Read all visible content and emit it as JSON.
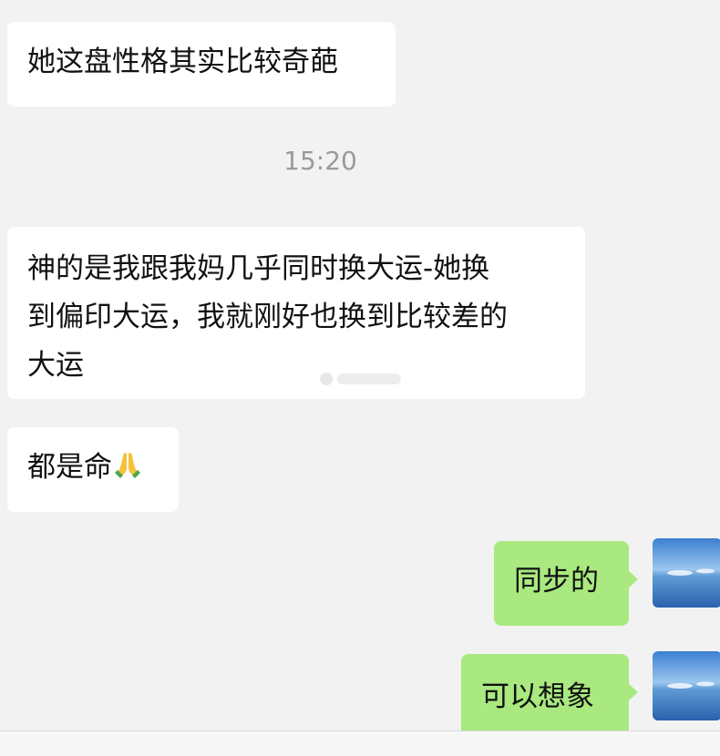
{
  "chat": {
    "timestamp": "15:20",
    "messages": [
      {
        "side": "incoming",
        "text": "她这盘性格其实比较奇葩"
      },
      {
        "side": "incoming",
        "text": "神的是我跟我妈几乎同时换大运-她换\n到偏印大运，我就刚好也换到比较差的\n大运"
      },
      {
        "side": "incoming",
        "text": "都是命",
        "emoji": "folded-hands-icon"
      },
      {
        "side": "outgoing",
        "text": "同步的"
      },
      {
        "side": "outgoing",
        "text": "可以想象"
      }
    ]
  },
  "colors": {
    "background": "#f2f2f2",
    "incoming_bubble": "#ffffff",
    "outgoing_bubble": "#a9e97f",
    "timestamp_text": "#9a9a9a"
  }
}
